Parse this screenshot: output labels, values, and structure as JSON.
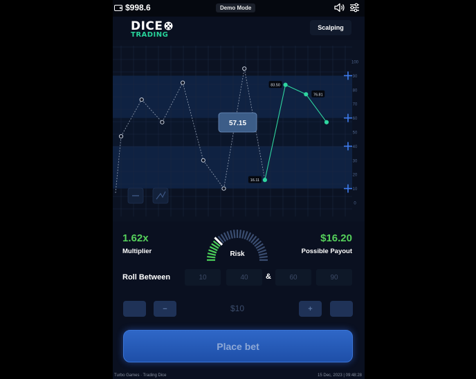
{
  "topbar": {
    "balance": "$998.6",
    "mode_badge": "Demo Mode"
  },
  "logo": {
    "line1": "DICE",
    "line2": "TRADING"
  },
  "mode_button": "Scalping",
  "chart_data": {
    "type": "line",
    "series": [
      {
        "points": [
          [
            1,
            47
          ],
          [
            2,
            73
          ],
          [
            3,
            57
          ],
          [
            4,
            85
          ],
          [
            5,
            30
          ],
          [
            6,
            10
          ],
          [
            7,
            95
          ],
          [
            8,
            16.11
          ],
          [
            9,
            83.5
          ],
          [
            10,
            76.81
          ],
          [
            11,
            57
          ]
        ]
      }
    ],
    "point_labels": [
      "",
      "",
      "",
      "",
      "",
      "",
      "",
      "16.11",
      "83.50",
      "76.81",
      ""
    ],
    "current_roll": "57.15",
    "y_ticks": [
      "100",
      "90",
      "80",
      "70",
      "60",
      "50",
      "40",
      "30",
      "20",
      "10",
      "0"
    ],
    "ylim": [
      0,
      100
    ],
    "highlight_range": [
      10,
      90
    ],
    "markers": [
      90,
      60,
      40,
      10
    ],
    "colors": {
      "past": "#8a96aa",
      "recent": "#2fd6a0"
    }
  },
  "stats": {
    "multiplier_value": "1.62x",
    "multiplier_label": "Multiplier",
    "payout_value": "$16.20",
    "payout_label": "Possible Payout",
    "risk_label": "Risk",
    "risk_level": 0.25
  },
  "roll": {
    "label": "Roll Between",
    "fields": [
      "10",
      "40",
      "60",
      "90"
    ],
    "joiner": "&"
  },
  "stake": {
    "amount": "$10",
    "minus": "−",
    "plus": "+"
  },
  "place_bet": "Place bet",
  "footer": {
    "left": "Turbo Games · Trading Dice",
    "right": "15 Dec, 2023 | 09:48:28"
  }
}
